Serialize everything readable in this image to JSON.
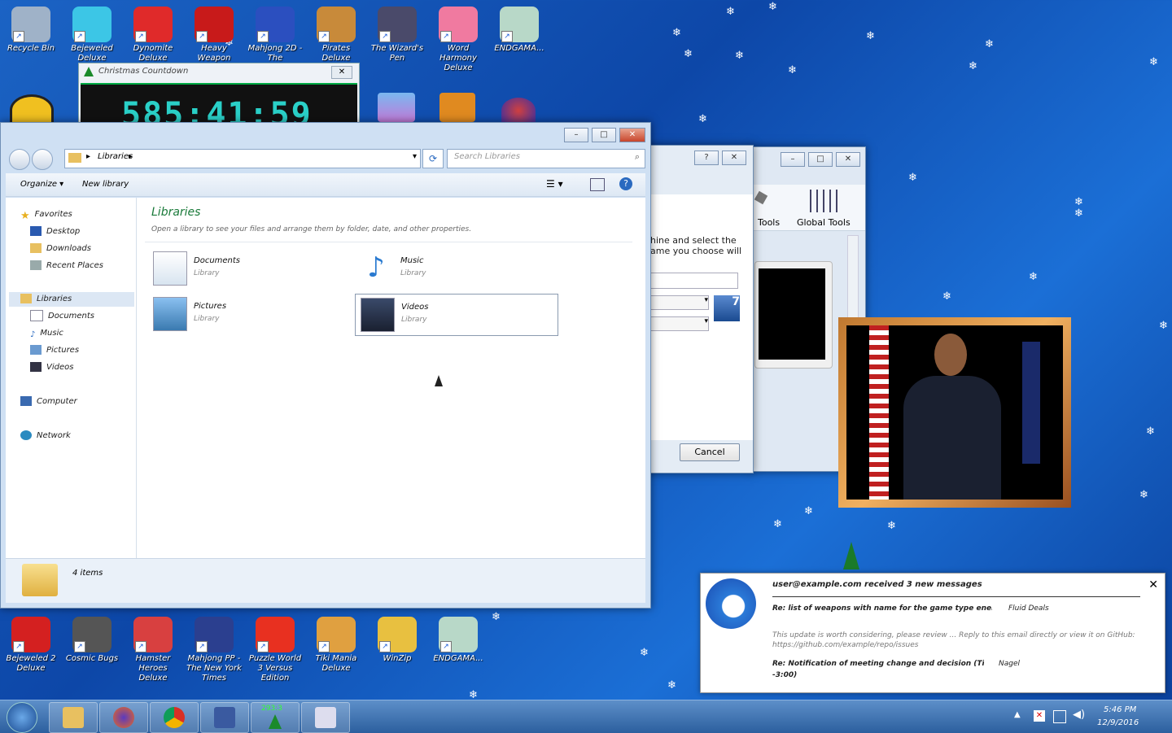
{
  "desktop_icons_top": [
    {
      "label": "Recycle Bin",
      "color": "#9fb2c8"
    },
    {
      "label": "Bejeweled Deluxe",
      "color": "#3cc6e6"
    },
    {
      "label": "Dynomite Deluxe",
      "color": "#e02a2a"
    },
    {
      "label": "Heavy Weapon",
      "color": "#c81a1a"
    },
    {
      "label": "Mahjong 2D - The",
      "color": "#2b4fbf"
    },
    {
      "label": "Pirates Deluxe",
      "color": "#c88a3a"
    },
    {
      "label": "The Wizard's Pen",
      "color": "#4a4a6a"
    },
    {
      "label": "Word Harmony Deluxe",
      "color": "#f07aa0"
    },
    {
      "label": "ENDGAMA...",
      "color": "#b8d8c8"
    }
  ],
  "desktop_icons_bottom": [
    {
      "label": "Bejeweled 2 Deluxe",
      "color": "#d42020"
    },
    {
      "label": "Cosmic Bugs",
      "color": "#555"
    },
    {
      "label": "Hamster Heroes Deluxe",
      "color": "#d84040"
    },
    {
      "label": "Mahjong PP - The New York Times",
      "color": "#2b3f8f"
    },
    {
      "label": "Puzzle World 3 Versus Edition",
      "color": "#e83020"
    },
    {
      "label": "Tiki Mania Deluxe",
      "color": "#e0a040"
    },
    {
      "label": "WinZip",
      "color": "#e8c040"
    },
    {
      "label": "ENDGAMA...",
      "color": "#b8d8c8"
    }
  ],
  "gadget": {
    "title": "Christmas Countdown",
    "time": "585:41:59",
    "close": "✕"
  },
  "explorer": {
    "path": "Libraries",
    "search_placeholder": "Search Libraries",
    "toolbar": {
      "organize": "Organize ▾",
      "new_library": "New library"
    },
    "nav": {
      "favorites": "Favorites",
      "desktop": "Desktop",
      "downloads": "Downloads",
      "recent": "Recent Places",
      "libraries": "Libraries",
      "documents": "Documents",
      "music": "Music",
      "pictures": "Pictures",
      "videos": "Videos",
      "computer": "Computer",
      "network": "Network"
    },
    "heading": "Libraries",
    "subheading": "Open a library to see your files and arrange them by folder, date, and other properties.",
    "libraries": [
      {
        "name": "Documents",
        "type": "Library"
      },
      {
        "name": "Music",
        "type": "Library"
      },
      {
        "name": "Pictures",
        "type": "Library"
      },
      {
        "name": "Videos",
        "type": "Library"
      }
    ],
    "status": "4 items"
  },
  "dialog": {
    "text_line1": "hine and select the",
    "text_line2": "ame you choose will",
    "cancel": "Cancel",
    "help": "?",
    "close": "✕"
  },
  "third_window": {
    "tools": "Tools",
    "global_tools": "Global Tools"
  },
  "notification": {
    "title": "user@example.com received 3 new messages",
    "m1_subject": "Re: list of weapons with name for the game type enemy boss",
    "m1_from": "Fluid Deals",
    "m1_body": "This update is worth considering, please review ... Reply to this email directly or view it on GitHub: https://github.com/example/repo/issues",
    "m2_subject": "Re: Notification of meeting change and decision (Time",
    "m2_from": "Nagel",
    "m2_tail": "-3:00)"
  },
  "tray": {
    "time": "5:46 PM",
    "date": "12/9/2016"
  },
  "counter_badge": "293:3"
}
